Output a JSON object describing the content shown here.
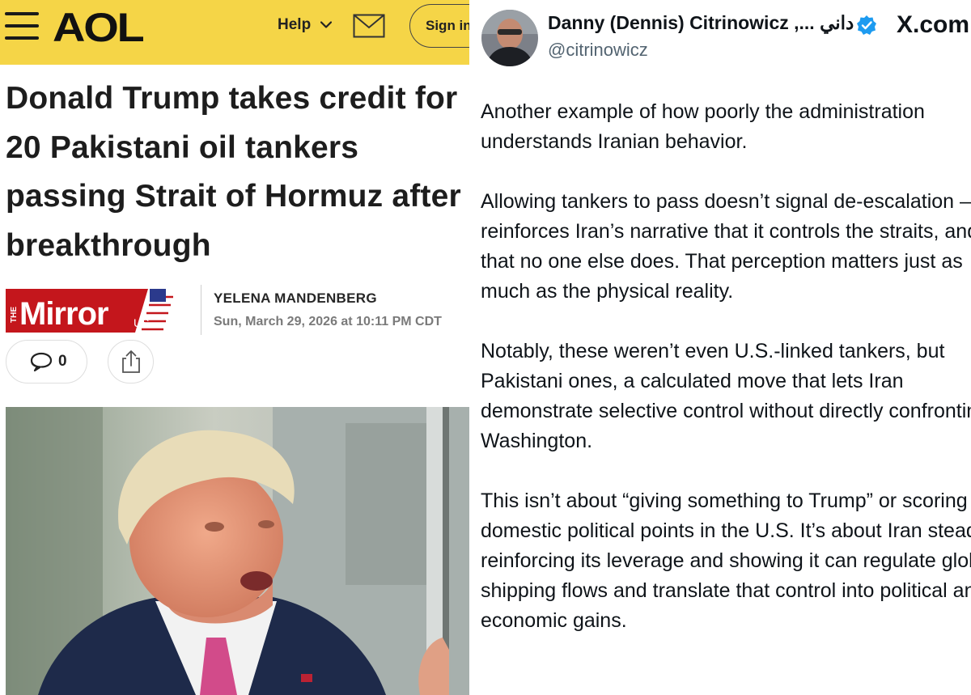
{
  "aol": {
    "logo": "AOL",
    "help_label": "Help",
    "signin_label": "Sign in",
    "headline": "Donald Trump takes credit for 20 Pakistani oil tankers passing Strait of Hormuz after breakthrough",
    "publisher_logo_text": "Mirror",
    "publisher_logo_prefix": "THE",
    "publisher_logo_suffix": "US",
    "author": "YELENA MANDENBERG",
    "date": "Sun, March 29, 2026 at 10:11 PM CDT",
    "comment_count": "0",
    "colors": {
      "header": "#f5d547",
      "mirror_red": "#c4161c"
    }
  },
  "tweet": {
    "display_name": "Danny (Dennis) Citrinowicz ,... داني",
    "handle": "@citrinowicz",
    "site": "X.com",
    "paragraphs": [
      "Another example of how poorly the administration understands Iranian behavior.",
      "Allowing tankers to pass doesn’t signal de-escalation — it reinforces Iran’s narrative that it controls the straits, and that no one else does. That perception matters just as much as the physical reality.",
      "Notably, these weren’t even U.S.-linked tankers, but Pakistani ones, a calculated move that lets Iran demonstrate selective control without directly confronting Washington.",
      "This isn’t about “giving something to Trump” or scoring domestic political points in the U.S. It’s about Iran steadily reinforcing its leverage and showing it can regulate global shipping flows and translate that control into political and economic gains."
    ],
    "colors": {
      "verified": "#1d9bf0",
      "handle": "#536471"
    }
  }
}
